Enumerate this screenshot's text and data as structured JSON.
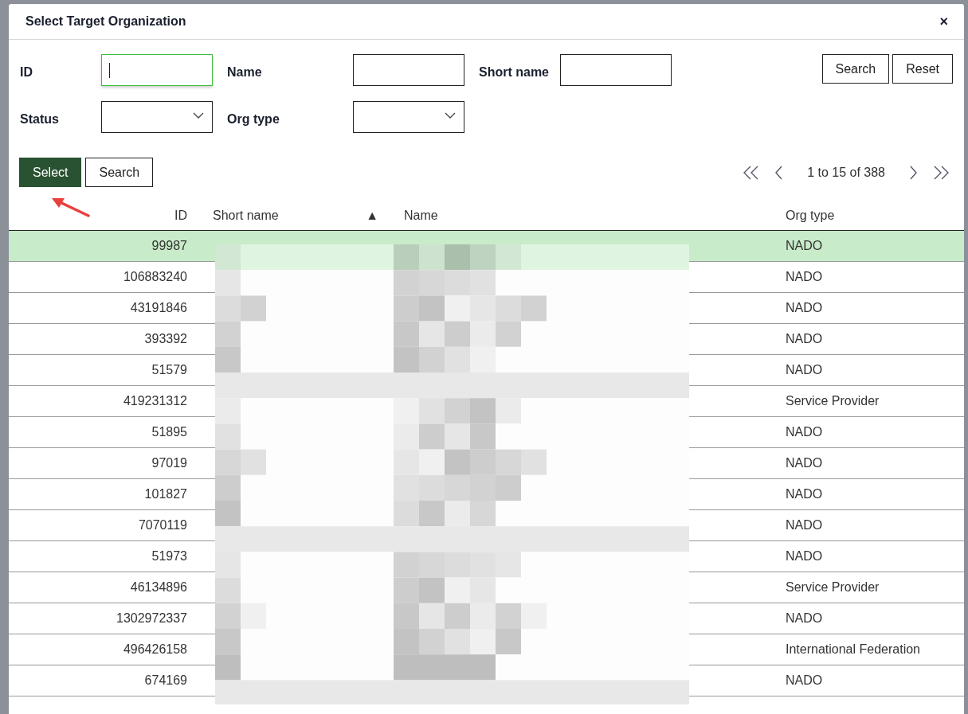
{
  "dialog": {
    "title": "Select Target Organization",
    "close": "×"
  },
  "filters": [
    {
      "label": "ID",
      "kind": "text",
      "focused": true
    },
    {
      "label": "Name",
      "kind": "text",
      "focused": false
    },
    {
      "label": "Short name",
      "kind": "text",
      "focused": false
    },
    {
      "label": "Status",
      "kind": "select",
      "focused": false
    },
    {
      "label": "Org type",
      "kind": "select",
      "focused": false
    }
  ],
  "filter_buttons": [
    "Search",
    "Reset"
  ],
  "actions": [
    {
      "label": "Select",
      "primary": true
    },
    {
      "label": "Search",
      "primary": false
    }
  ],
  "pagination": {
    "range": "1 to 15 of 388"
  },
  "table": {
    "columns": [
      {
        "label": "ID"
      },
      {
        "label": "Short name",
        "sort_indicator": "▲"
      },
      {
        "label": "Name"
      },
      {
        "label": "Org type"
      }
    ],
    "rows": [
      {
        "id": "99987",
        "org_type": "NADO",
        "selected": true
      },
      {
        "id": "106883240",
        "org_type": "NADO",
        "selected": false
      },
      {
        "id": "43191846",
        "org_type": "NADO",
        "selected": false
      },
      {
        "id": "393392",
        "org_type": "NADO",
        "selected": false
      },
      {
        "id": "51579",
        "org_type": "NADO",
        "selected": false
      },
      {
        "id": "419231312",
        "org_type": "Service Provider",
        "selected": false
      },
      {
        "id": "51895",
        "org_type": "NADO",
        "selected": false
      },
      {
        "id": "97019",
        "org_type": "NADO",
        "selected": false
      },
      {
        "id": "101827",
        "org_type": "NADO",
        "selected": false
      },
      {
        "id": "7070119",
        "org_type": "NADO",
        "selected": false
      },
      {
        "id": "51973",
        "org_type": "NADO",
        "selected": false
      },
      {
        "id": "46134896",
        "org_type": "Service Provider",
        "selected": false
      },
      {
        "id": "1302972337",
        "org_type": "NADO",
        "selected": false
      },
      {
        "id": "496426158",
        "org_type": "International Federation",
        "selected": false
      },
      {
        "id": "674169",
        "org_type": "NADO",
        "selected": false
      }
    ]
  }
}
